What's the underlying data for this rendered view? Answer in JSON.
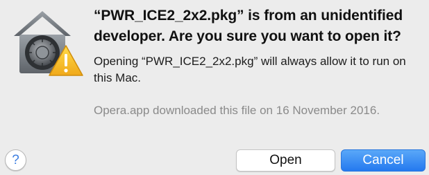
{
  "dialog": {
    "title": "“PWR_ICE2_2x2.pkg” is from an unidentified developer. Are you sure you want to open it?",
    "info": "Opening “PWR_ICE2_2x2.pkg” will always allow it to run on this Mac.",
    "source": "Opera.app downloaded this file on 16 November 2016.",
    "help_label": "?",
    "open_label": "Open",
    "cancel_label": "Cancel",
    "icon": "gatekeeper-warning-icon"
  },
  "colors": {
    "accent": "#2479ef",
    "warning": "#f5c21b",
    "background": "#ececec"
  }
}
